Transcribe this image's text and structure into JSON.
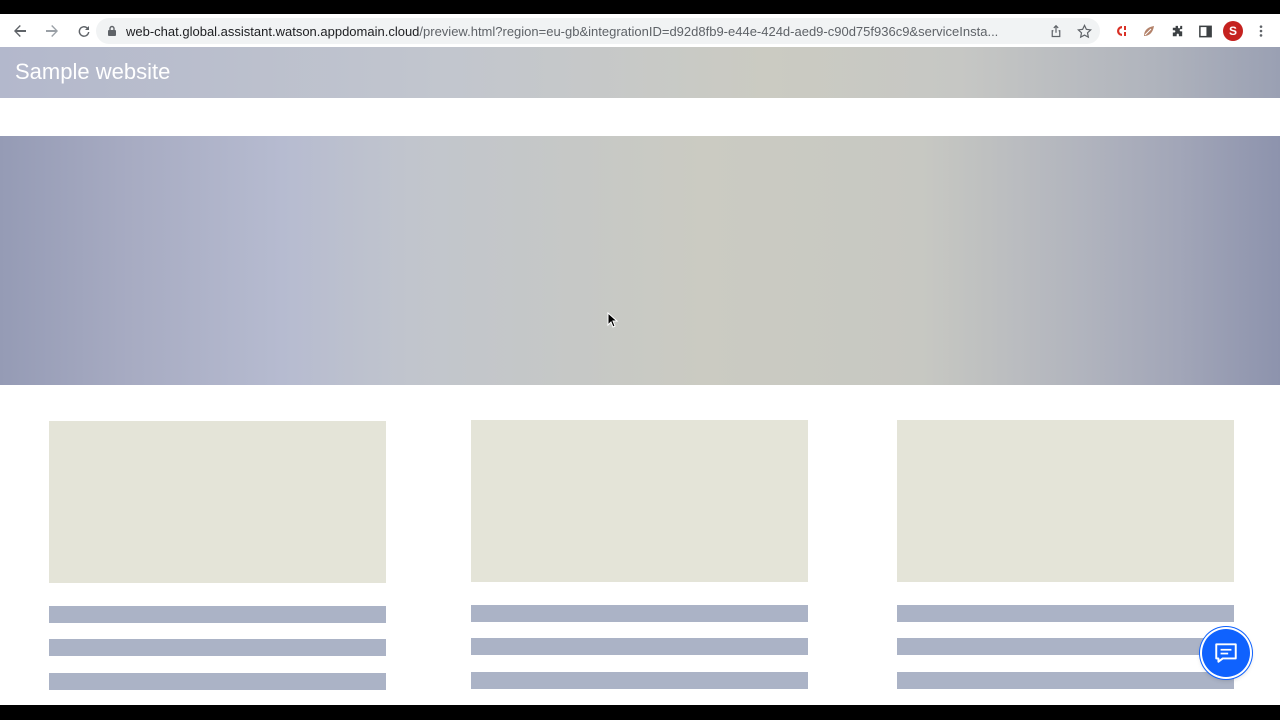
{
  "browser": {
    "url_host": "web-chat.global.assistant.watson.appdomain.cloud",
    "url_path": "/preview.html?region=eu-gb&integrationID=d92d8fb9-e44e-424d-aed9-c90d75f936c9&serviceInsta...",
    "profile_initial": "S",
    "icons": [
      "back-icon",
      "forward-icon",
      "reload-icon",
      "lock-icon",
      "share-icon",
      "star-icon",
      "extension-c-icon",
      "extension-leaf-icon",
      "puzzle-icon",
      "side-panel-icon"
    ]
  },
  "site": {
    "title": "Sample website"
  },
  "cards": [
    {
      "id": "card-1"
    },
    {
      "id": "card-2"
    },
    {
      "id": "card-3"
    }
  ],
  "chat_launcher": {
    "icon": "chat-bubble-icon",
    "color": "#0f62fe"
  },
  "colors": {
    "card_image": "#e4e4d8",
    "card_line": "#abb3c6"
  }
}
